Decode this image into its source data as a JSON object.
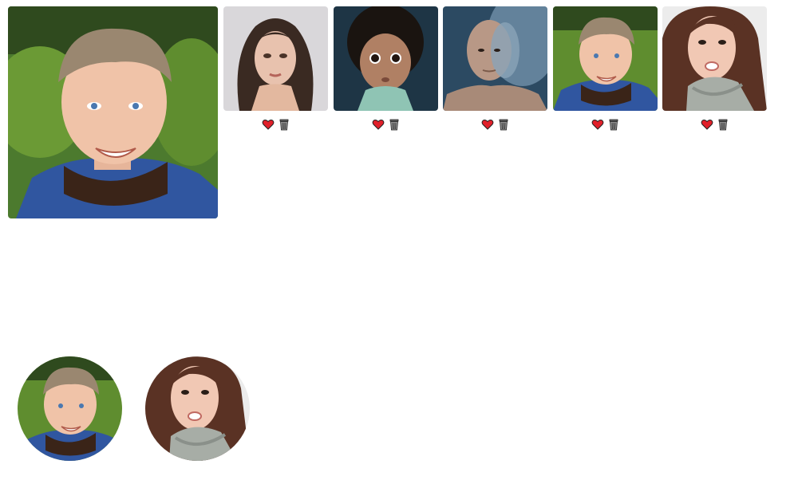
{
  "main_photo": {
    "subject": "boy",
    "icon": "photo-boy"
  },
  "thumbnails": [
    {
      "subject": "woman-dark-hair",
      "actions": [
        {
          "icon": "heart-icon",
          "color": "#e0202a"
        },
        {
          "icon": "trash-icon",
          "color": "#808080"
        }
      ]
    },
    {
      "subject": "toddler-curly-hair",
      "actions": [
        {
          "icon": "heart-icon",
          "color": "#e0202a"
        },
        {
          "icon": "trash-icon",
          "color": "#808080"
        }
      ]
    },
    {
      "subject": "man-bald",
      "actions": [
        {
          "icon": "heart-icon",
          "color": "#e0202a"
        },
        {
          "icon": "trash-icon",
          "color": "#808080"
        }
      ]
    },
    {
      "subject": "boy",
      "actions": [
        {
          "icon": "heart-icon",
          "color": "#e0202a"
        },
        {
          "icon": "trash-icon",
          "color": "#808080"
        }
      ]
    },
    {
      "subject": "woman-scarf",
      "actions": [
        {
          "icon": "heart-icon",
          "color": "#e0202a"
        },
        {
          "icon": "trash-icon",
          "color": "#808080"
        }
      ]
    }
  ],
  "favorites": [
    {
      "subject": "boy"
    },
    {
      "subject": "woman-scarf"
    }
  ]
}
